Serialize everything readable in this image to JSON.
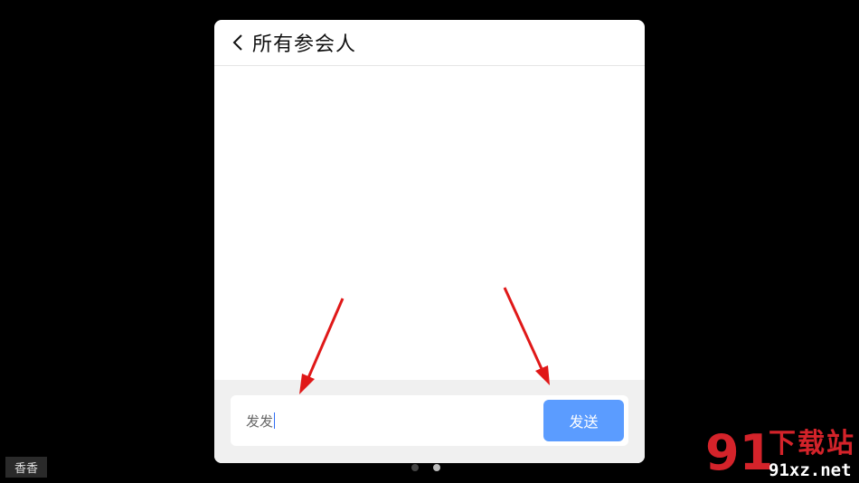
{
  "dialog": {
    "title": "所有参会人",
    "back_icon": "chevron-left-icon"
  },
  "chat": {
    "input_value": "发发",
    "send_label": "发送"
  },
  "user_tag": "香香",
  "pager": {
    "count": 2
  },
  "annotation": {
    "color": "#e01818"
  },
  "watermark": {
    "number": "91",
    "text": "下载站",
    "url": "91xz.net"
  },
  "colors": {
    "send_button": "#5b9cff",
    "background": "#000000",
    "watermark": "#d4232a"
  }
}
